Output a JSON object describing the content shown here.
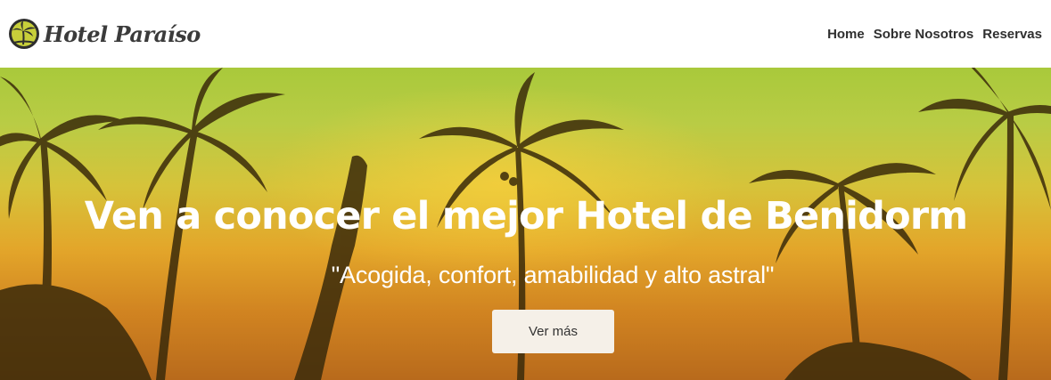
{
  "brand": {
    "name": "Hotel Paraíso",
    "icon": "palm-tree-logo-icon"
  },
  "nav": {
    "items": [
      {
        "label": "Home"
      },
      {
        "label": "Sobre Nosotros"
      },
      {
        "label": "Reservas"
      }
    ]
  },
  "hero": {
    "title": "Ven a conocer el mejor Hotel de Benidorm",
    "subtitle": "\"Acogida, confort, amabilidad y alto astral\"",
    "cta_label": "Ver más"
  },
  "colors": {
    "navbar_bg": "#ffffff",
    "nav_text": "#2f2f2f",
    "hero_text": "#ffffff",
    "cta_bg": "#f5f0e8"
  }
}
